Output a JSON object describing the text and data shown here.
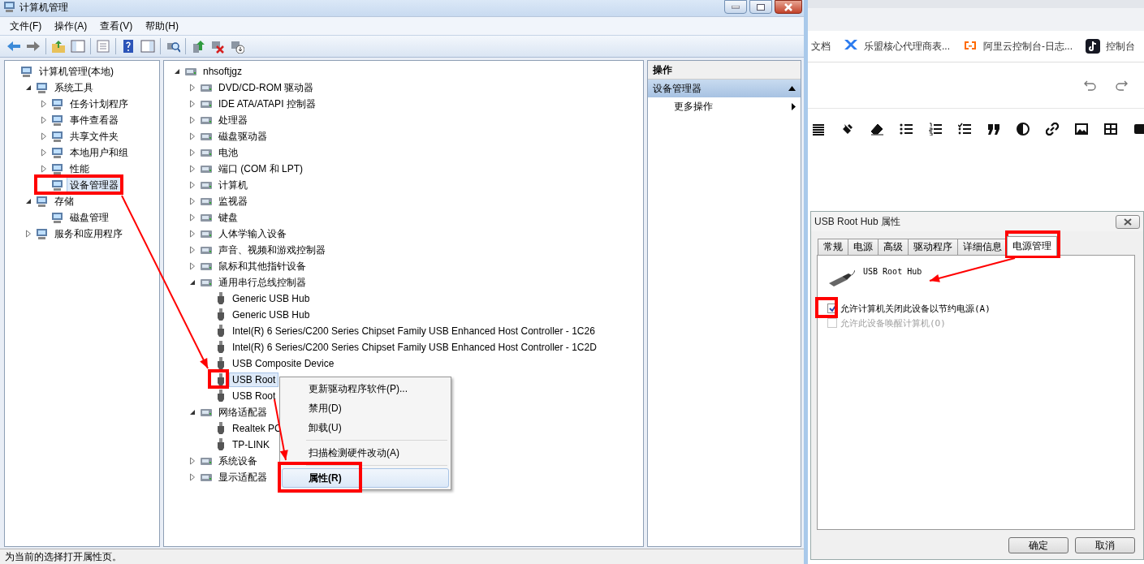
{
  "window": {
    "title": "计算机管理"
  },
  "menu": [
    "文件(F)",
    "操作(A)",
    "查看(V)",
    "帮助(H)"
  ],
  "nav_tree": [
    {
      "label": "计算机管理(本地)",
      "selected": false,
      "children": [
        {
          "label": "系统工具",
          "selected": false,
          "expanded": true,
          "children": [
            {
              "label": "任务计划程序",
              "selected": false,
              "expanded": false
            },
            {
              "label": "事件查看器",
              "selected": false,
              "expanded": false
            },
            {
              "label": "共享文件夹",
              "selected": false,
              "expanded": false
            },
            {
              "label": "本地用户和组",
              "selected": false,
              "expanded": false
            },
            {
              "label": "性能",
              "selected": false,
              "expanded": false
            },
            {
              "label": "设备管理器",
              "selected": true
            }
          ]
        },
        {
          "label": "存储",
          "selected": false,
          "expanded": true,
          "children": [
            {
              "label": "磁盘管理",
              "selected": false
            }
          ]
        },
        {
          "label": "服务和应用程序",
          "selected": false,
          "expanded": false
        }
      ]
    }
  ],
  "device_tree": [
    {
      "label": "nhsoftjgz",
      "selected": false,
      "expanded": true,
      "children": [
        {
          "label": "DVD/CD-ROM 驱动器",
          "selected": false,
          "expanded": false
        },
        {
          "label": "IDE ATA/ATAPI 控制器",
          "selected": false,
          "expanded": false
        },
        {
          "label": "处理器",
          "selected": false,
          "expanded": false
        },
        {
          "label": "磁盘驱动器",
          "selected": false,
          "expanded": false
        },
        {
          "label": "电池",
          "selected": false,
          "expanded": false
        },
        {
          "label": "端口 (COM 和 LPT)",
          "selected": false,
          "expanded": false
        },
        {
          "label": "计算机",
          "selected": false,
          "expanded": false
        },
        {
          "label": "监视器",
          "selected": false,
          "expanded": false
        },
        {
          "label": "键盘",
          "selected": false,
          "expanded": false
        },
        {
          "label": "人体学输入设备",
          "selected": false,
          "expanded": false
        },
        {
          "label": "声音、视频和游戏控制器",
          "selected": false,
          "expanded": false
        },
        {
          "label": "鼠标和其他指针设备",
          "selected": false,
          "expanded": false
        },
        {
          "label": "通用串行总线控制器",
          "selected": false,
          "expanded": true,
          "children": [
            {
              "label": "Generic USB Hub",
              "selected": false
            },
            {
              "label": "Generic USB Hub",
              "selected": false
            },
            {
              "label": "Intel(R) 6 Series/C200 Series Chipset Family USB Enhanced Host Controller - 1C26",
              "selected": false
            },
            {
              "label": "Intel(R) 6 Series/C200 Series Chipset Family USB Enhanced Host Controller - 1C2D",
              "selected": false
            },
            {
              "label": "USB Composite Device",
              "selected": false
            },
            {
              "label": "USB Root",
              "selected": true
            },
            {
              "label": "USB Root",
              "selected": false
            }
          ]
        },
        {
          "label": "网络适配器",
          "selected": false,
          "expanded": true,
          "children": [
            {
              "label": "Realtek PC",
              "selected": false
            },
            {
              "label": "TP-LINK",
              "selected": false
            }
          ]
        },
        {
          "label": "系统设备",
          "selected": false,
          "expanded": false
        },
        {
          "label": "显示适配器",
          "selected": false,
          "expanded": false
        }
      ]
    }
  ],
  "actions": {
    "header": "操作",
    "section": "设备管理器",
    "items": [
      "更多操作"
    ]
  },
  "context_menu": [
    {
      "kind": "item",
      "label": "更新驱动程序软件(P)...",
      "selected": false
    },
    {
      "kind": "item",
      "label": "禁用(D)",
      "selected": false
    },
    {
      "kind": "item",
      "label": "卸载(U)",
      "selected": false
    },
    {
      "kind": "separator"
    },
    {
      "kind": "item",
      "label": "扫描检测硬件改动(A)",
      "selected": false
    },
    {
      "kind": "separator"
    },
    {
      "kind": "item",
      "label": "属性(R)",
      "selected": true
    }
  ],
  "status_bar": "为当前的选择打开属性页。",
  "browser": {
    "bookmarks": [
      "文档",
      "乐盟核心代理商表...",
      "阿里云控制台-日志...",
      "控制台"
    ]
  },
  "dialog": {
    "title": "USB Root Hub 属性",
    "tabs": [
      {
        "label": "常规",
        "selected": false
      },
      {
        "label": "电源",
        "selected": false
      },
      {
        "label": "高级",
        "selected": false
      },
      {
        "label": "驱动程序",
        "selected": false
      },
      {
        "label": "详细信息",
        "selected": false
      },
      {
        "label": "电源管理",
        "selected": true
      }
    ],
    "device_name": "USB Root Hub",
    "options": [
      {
        "label": "允许计算机关闭此设备以节约电源(A)",
        "checked": true,
        "disabled": false
      },
      {
        "label": "允许此设备唤醒计算机(O)",
        "checked": false,
        "disabled": true
      }
    ],
    "buttons": [
      "确定",
      "取消"
    ]
  }
}
